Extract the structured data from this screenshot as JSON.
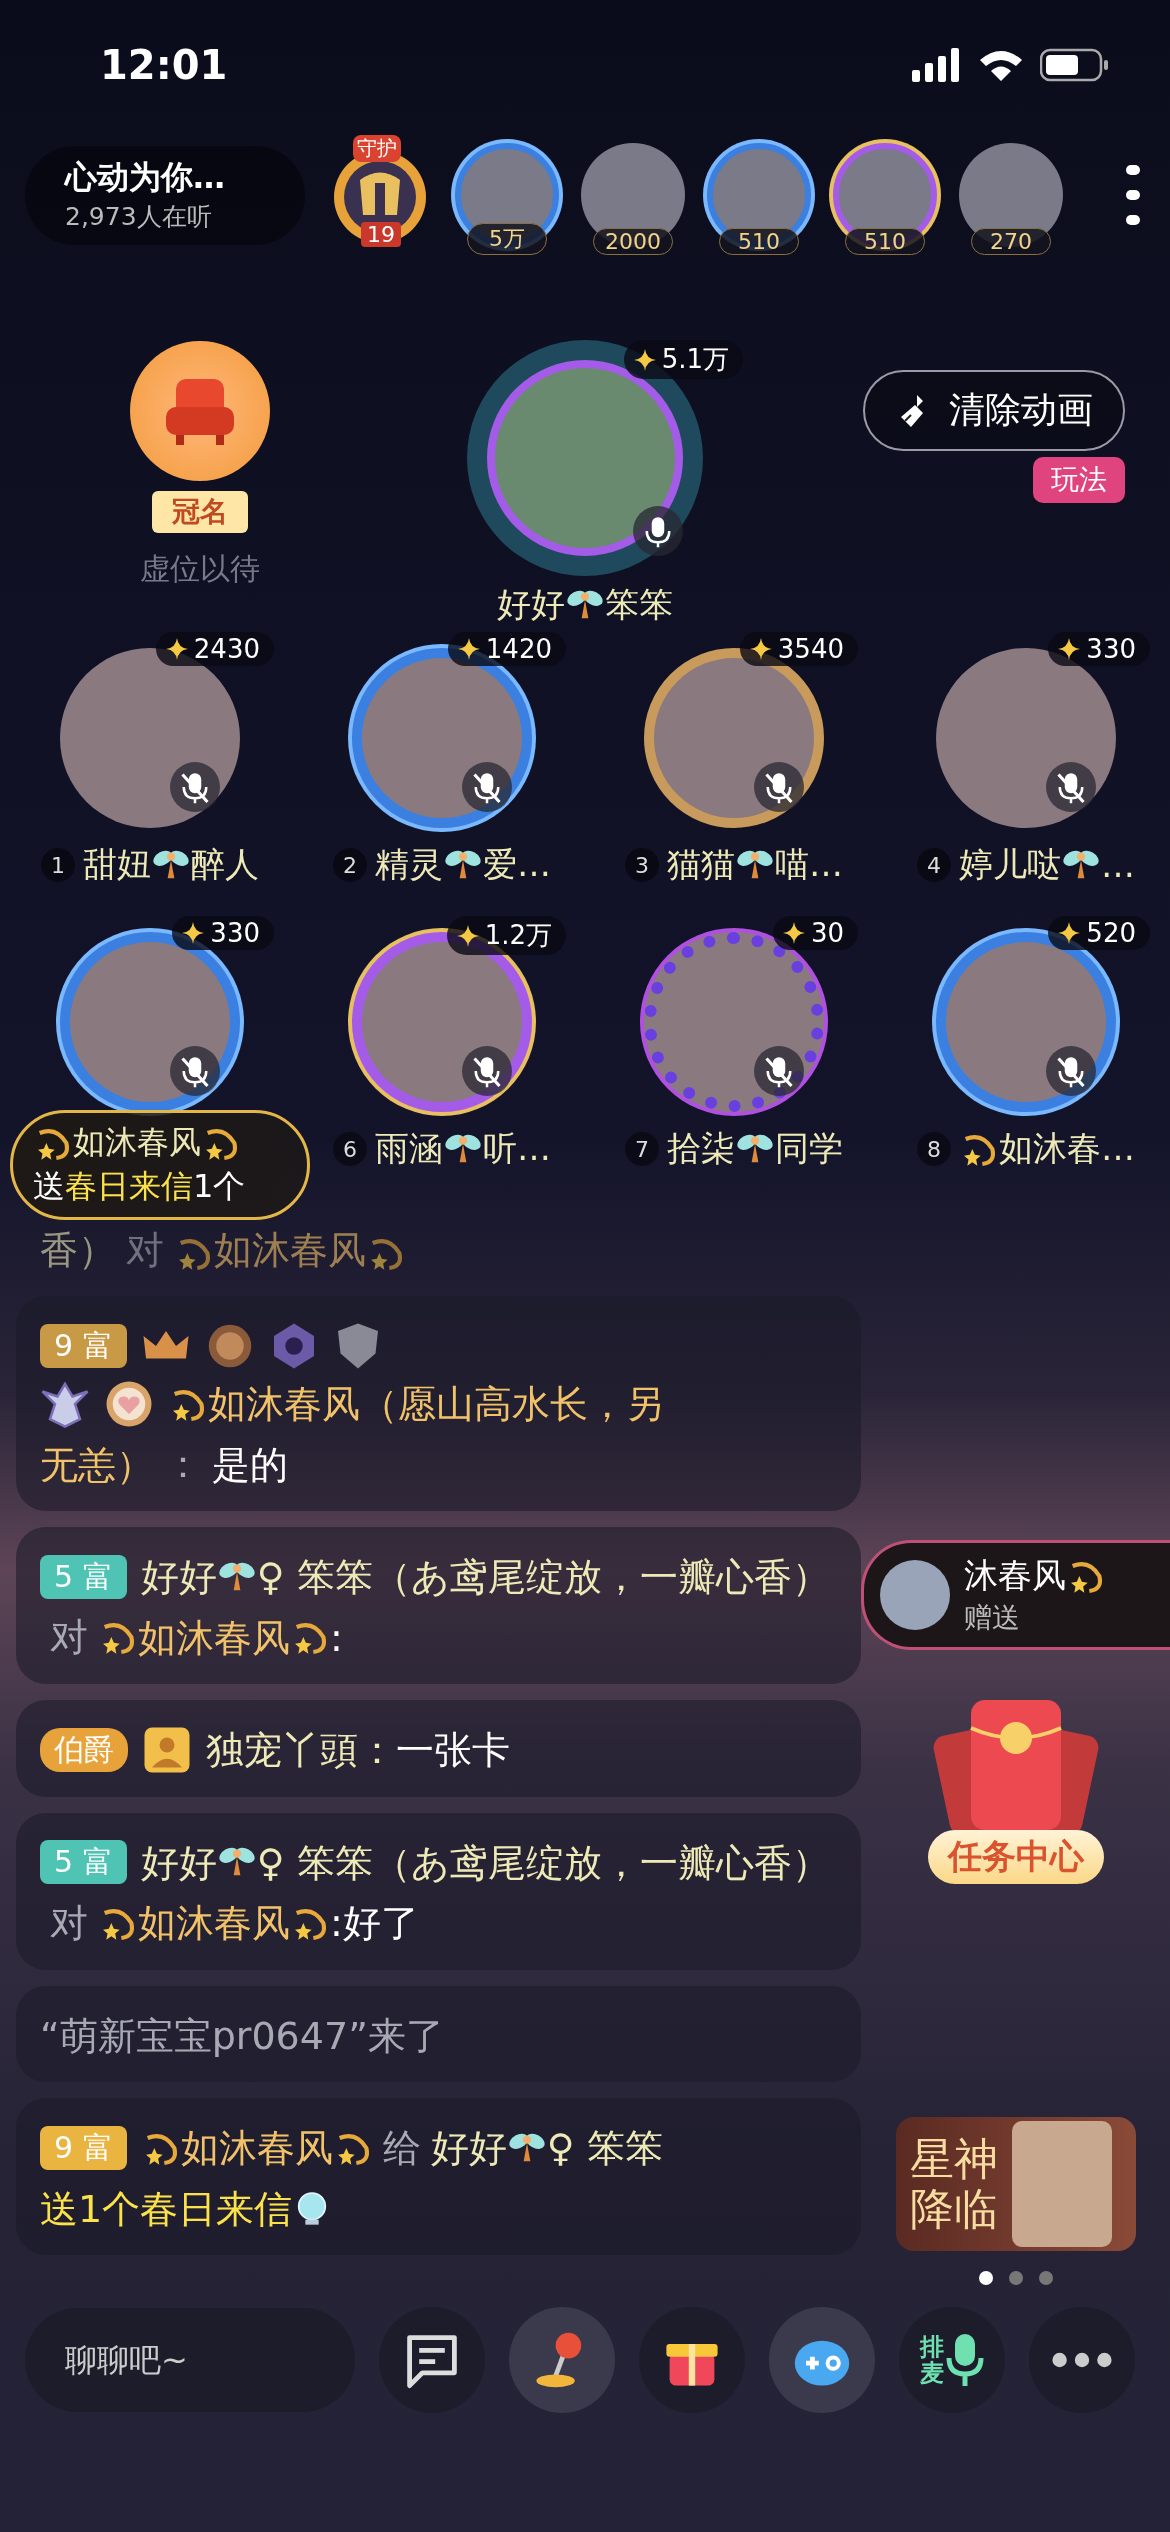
{
  "status_bar": {
    "time": "12:01"
  },
  "room": {
    "title": "心动为你…",
    "listeners": "2,973人在听"
  },
  "guard_badge": {
    "label": "守护",
    "level": "19"
  },
  "top_viewers": [
    {
      "score": "5万",
      "kind": "blue"
    },
    {
      "score": "2000",
      "kind": "plain"
    },
    {
      "score": "510",
      "kind": "blue"
    },
    {
      "score": "510",
      "kind": "purple"
    },
    {
      "score": "270",
      "kind": "plain"
    }
  ],
  "crown_seat": {
    "label": "冠名",
    "caption": "虚位以待"
  },
  "host_seat": {
    "score": "5.1万",
    "muted": false,
    "name": [
      {
        "kind": "name",
        "text": "好好"
      },
      {
        "kind": "fairy"
      },
      {
        "kind": "name",
        "text": "笨笨"
      }
    ]
  },
  "clear_animation_button": {
    "label": "清除动画"
  },
  "play_tag": {
    "label": "玩法"
  },
  "seats": [
    {
      "number": "1",
      "score": "2430",
      "muted": true,
      "kind": "plain",
      "name": [
        {
          "kind": "name",
          "text": "甜妞"
        },
        {
          "kind": "fairy"
        },
        {
          "kind": "name",
          "text": "醉人"
        }
      ]
    },
    {
      "number": "2",
      "score": "1420",
      "muted": true,
      "kind": "blue",
      "name": [
        {
          "kind": "name",
          "text": "精灵"
        },
        {
          "kind": "fairy"
        },
        {
          "kind": "name",
          "text": "爱…"
        }
      ]
    },
    {
      "number": "3",
      "score": "3540",
      "muted": true,
      "kind": "gold",
      "name": [
        {
          "kind": "name",
          "text": "猫猫"
        },
        {
          "kind": "fairy"
        },
        {
          "kind": "name",
          "text": "喵…"
        }
      ]
    },
    {
      "number": "4",
      "score": "330",
      "muted": true,
      "kind": "plain",
      "name": [
        {
          "kind": "name",
          "text": "婷儿哒"
        },
        {
          "kind": "fairy"
        },
        {
          "kind": "name",
          "text": "…"
        }
      ]
    },
    {
      "score": "330",
      "muted": true,
      "kind": "blue"
    },
    {
      "number": "6",
      "score": "1.2万",
      "muted": true,
      "kind": "purple",
      "name": [
        {
          "kind": "name",
          "text": "雨涵"
        },
        {
          "kind": "fairy"
        },
        {
          "kind": "name",
          "text": "听…"
        }
      ]
    },
    {
      "number": "7",
      "score": "30",
      "muted": true,
      "kind": "night",
      "name": [
        {
          "kind": "name",
          "text": "拾柒"
        },
        {
          "kind": "fairy"
        },
        {
          "kind": "name",
          "text": "同学"
        }
      ]
    },
    {
      "number": "8",
      "score": "520",
      "muted": true,
      "kind": "blue",
      "name": [
        {
          "kind": "sparkle"
        },
        {
          "kind": "name",
          "text": "如沐春…"
        }
      ]
    }
  ],
  "gift_banner": {
    "sender": [
      {
        "kind": "sparkle"
      },
      {
        "kind": "name",
        "text": "如沐春风"
      },
      {
        "kind": "sparkle"
      }
    ],
    "message": [
      {
        "kind": "content",
        "text": "送"
      },
      {
        "kind": "gift",
        "text": "春日来信"
      },
      {
        "kind": "content",
        "text": "1个"
      }
    ]
  },
  "chat": {
    "faded_line": [
      {
        "kind": "name",
        "text": "香）"
      },
      {
        "kind": "muted",
        "text": "对"
      },
      {
        "kind": "sparkle"
      },
      {
        "kind": "vip",
        "text": "如沐春风"
      },
      {
        "kind": "sparkle"
      }
    ],
    "messages": [
      {
        "kind": "chat",
        "badges": [
          {
            "kind": "level",
            "label": "9 富",
            "color": "#c99a45"
          },
          {
            "kind": "crown"
          },
          {
            "kind": "medal"
          },
          {
            "kind": "emblem"
          },
          {
            "kind": "shield"
          }
        ],
        "segments": [
          {
            "kind": "break"
          },
          {
            "kind": "wing-badge"
          },
          {
            "kind": "heart-badge"
          },
          {
            "kind": "sparkle"
          },
          {
            "kind": "vip",
            "text": "如沐春风"
          },
          {
            "kind": "vip",
            "text": "（愿山高水长，另"
          },
          {
            "kind": "break"
          },
          {
            "kind": "vip",
            "text": "无恙）"
          },
          {
            "kind": "muted",
            "text": "："
          },
          {
            "kind": "content",
            "text": "是的"
          }
        ]
      },
      {
        "kind": "chat",
        "badges": [
          {
            "kind": "level",
            "label": "5 富",
            "color": "#4fc3b4"
          }
        ],
        "segments": [
          {
            "kind": "name",
            "text": "好好"
          },
          {
            "kind": "fairy"
          },
          {
            "kind": "name",
            "text": "♀ 笨笨（あ鸢尾绽放，一瓣心香）"
          },
          {
            "kind": "muted",
            "text": "对"
          },
          {
            "kind": "sparkle"
          },
          {
            "kind": "vip",
            "text": "如沐春风"
          },
          {
            "kind": "sparkle"
          },
          {
            "kind": "content",
            "text": ":"
          }
        ]
      },
      {
        "kind": "chat",
        "badges": [
          {
            "kind": "title",
            "label": "伯爵",
            "color": "#e8a23a"
          },
          {
            "kind": "avatar-badge"
          }
        ],
        "segments": [
          {
            "kind": "name",
            "text": "独宠丫頭："
          },
          {
            "kind": "content",
            "text": "一张卡"
          }
        ]
      },
      {
        "kind": "chat",
        "badges": [
          {
            "kind": "level",
            "label": "5 富",
            "color": "#4fc3b4"
          }
        ],
        "segments": [
          {
            "kind": "name",
            "text": "好好"
          },
          {
            "kind": "fairy"
          },
          {
            "kind": "name",
            "text": "♀ 笨笨（あ鸢尾绽放，一瓣心香）"
          },
          {
            "kind": "muted",
            "text": "对"
          },
          {
            "kind": "sparkle"
          },
          {
            "kind": "vip",
            "text": "如沐春风"
          },
          {
            "kind": "sparkle"
          },
          {
            "kind": "content",
            "text": ":好了"
          }
        ]
      },
      {
        "kind": "system",
        "segments": [
          {
            "kind": "muted",
            "text": "“萌新宝宝pr0647”来了"
          }
        ]
      },
      {
        "kind": "chat",
        "badges": [
          {
            "kind": "level",
            "label": "9 富",
            "color": "#e9b440"
          }
        ],
        "segments": [
          {
            "kind": "sparkle"
          },
          {
            "kind": "vip",
            "text": "如沐春风"
          },
          {
            "kind": "sparkle"
          },
          {
            "kind": "muted",
            "text": "给"
          },
          {
            "kind": "name",
            "text": "好好"
          },
          {
            "kind": "fairy"
          },
          {
            "kind": "name",
            "text": "♀ 笨笨"
          },
          {
            "kind": "break"
          },
          {
            "kind": "gift",
            "text": "送1个春日来信"
          },
          {
            "kind": "gift-icon"
          }
        ]
      }
    ]
  },
  "gift_notice": {
    "sender": "沐春风",
    "action": "赠送"
  },
  "task_center": {
    "label": "任务中心"
  },
  "promo_banner": {
    "title": "星神降临"
  },
  "carousel_dots": [
    {
      "selected": true
    },
    {
      "selected": false
    },
    {
      "selected": false
    }
  ],
  "bottom_bar": {
    "input": {
      "placeholder": "聊聊吧~"
    },
    "buttons": [
      {
        "kind": "chat"
      },
      {
        "kind": "joystick"
      },
      {
        "kind": "gift"
      },
      {
        "kind": "game"
      },
      {
        "kind": "queue",
        "label": "排麦"
      },
      {
        "kind": "more"
      }
    ]
  }
}
